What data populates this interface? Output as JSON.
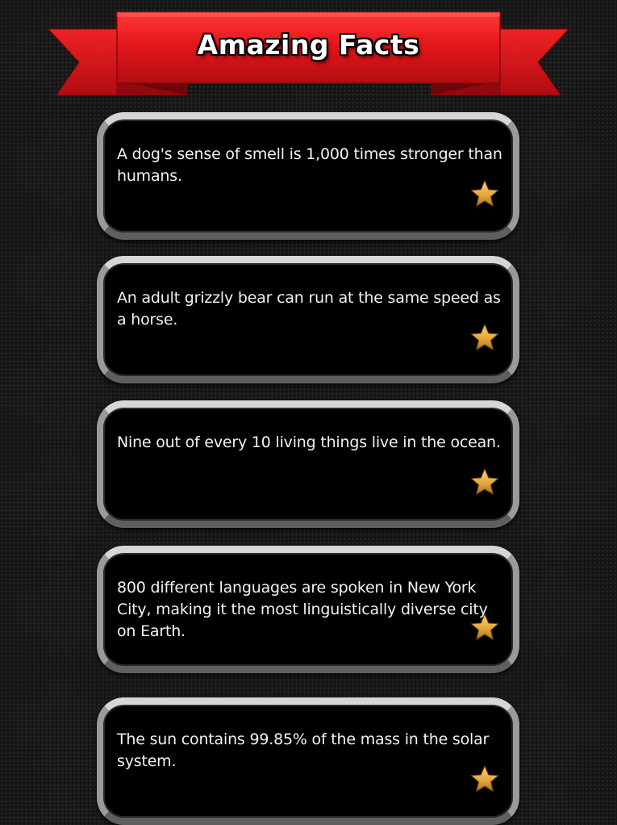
{
  "header": {
    "title": "Amazing Facts"
  },
  "colors": {
    "ribbon_red": "#e4161b",
    "ribbon_dark_red": "#8f0a0e",
    "card_border_light": "#d6d6d6",
    "card_background": "#000000",
    "star_gold": "#e1a43a"
  },
  "facts": [
    {
      "text": "A dog's sense of smell is 1,000 times stronger than humans.",
      "icon": "star-icon"
    },
    {
      "text": "An adult grizzly bear can run at the same speed as a horse.",
      "icon": "star-icon"
    },
    {
      "text": "Nine out of every 10 living things live in the ocean.",
      "icon": "star-icon"
    },
    {
      "text": "800 different languages are spoken in New York City, making it the most linguistically diverse city on Earth.",
      "icon": "star-icon"
    },
    {
      "text": "The sun contains 99.85% of the mass in the solar system.",
      "icon": "star-icon"
    }
  ]
}
